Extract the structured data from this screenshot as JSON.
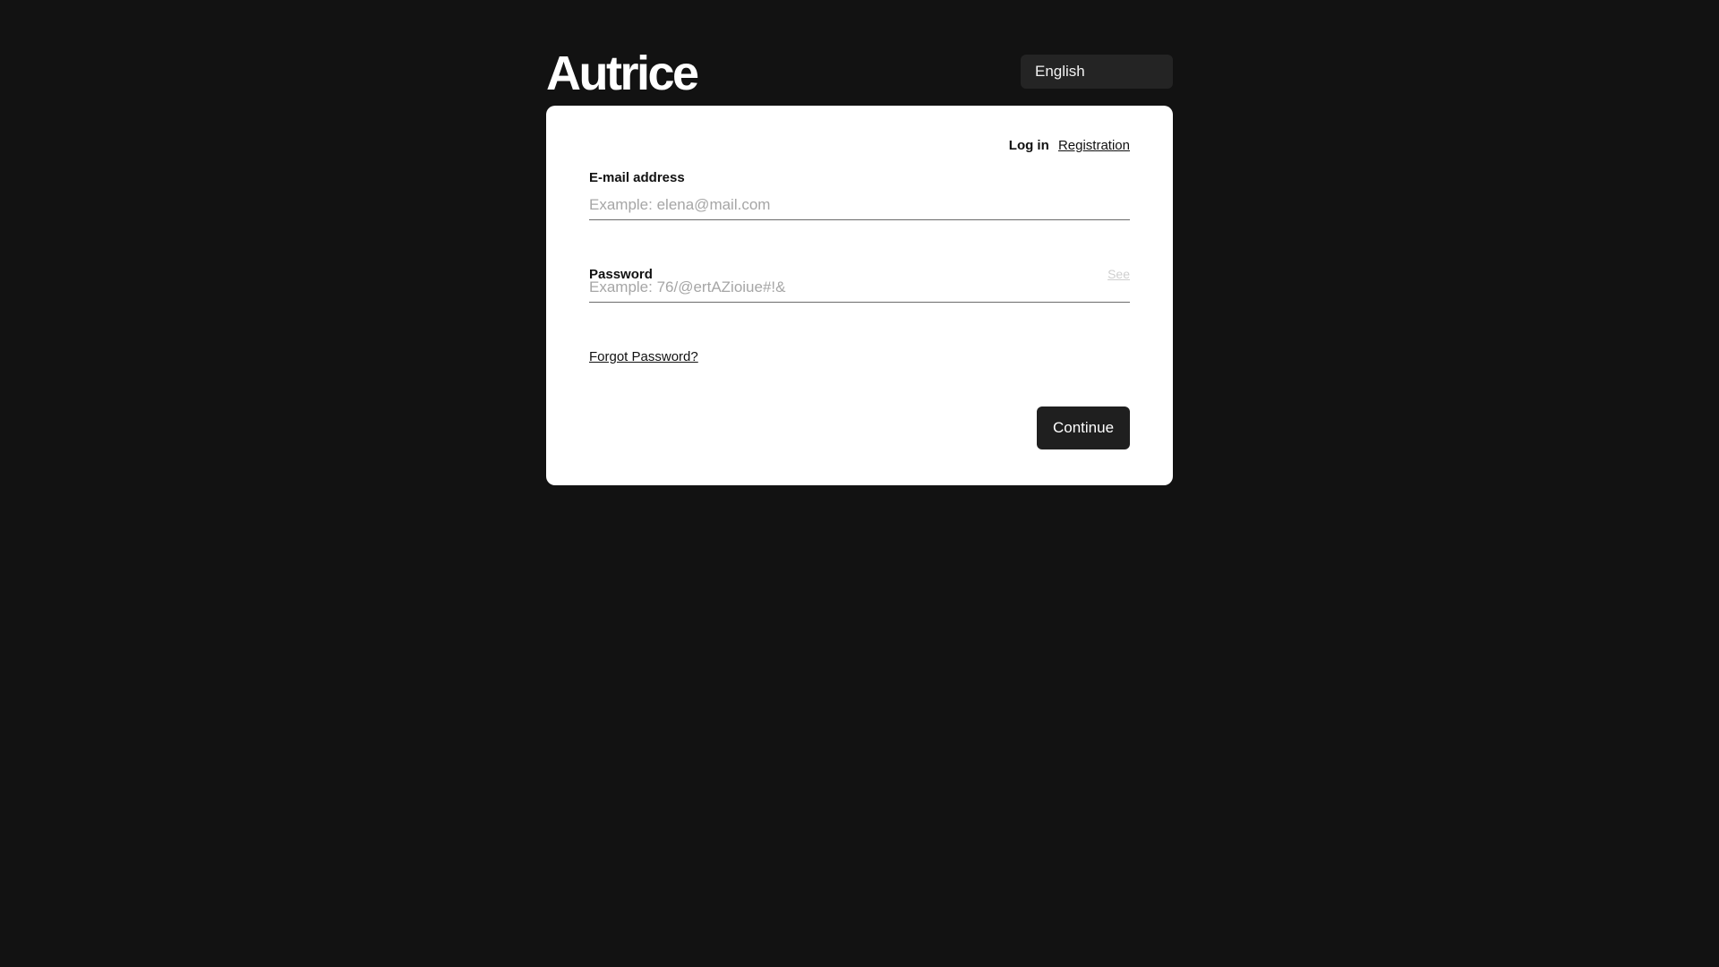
{
  "brand": {
    "logo_text": "Autrice"
  },
  "language_selector": {
    "selected": "English"
  },
  "auth_tabs": {
    "login": "Log in",
    "registration": "Registration"
  },
  "email_field": {
    "label": "E-mail address",
    "placeholder": "Example: elena@mail.com",
    "value": ""
  },
  "password_field": {
    "label": "Password",
    "placeholder": "Example: 76/@ertAZioiue#!&",
    "value": "",
    "toggle_label": "See"
  },
  "forgot_password": "Forgot Password?",
  "continue_button": "Continue",
  "colors": {
    "background": "#121212",
    "card": "#ffffff",
    "button": "#1f1f1f",
    "language_selector": "#242424"
  }
}
